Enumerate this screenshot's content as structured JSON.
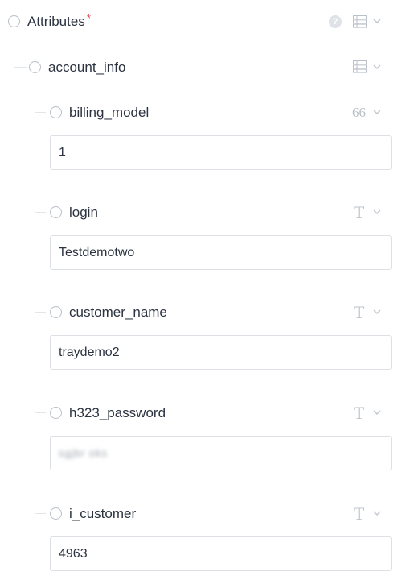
{
  "root": {
    "label": "Attributes",
    "required_marker": "*",
    "help_icon": "?",
    "type_icon": "list-icon"
  },
  "group": {
    "label": "account_info",
    "type_icon": "list-icon"
  },
  "fields": [
    {
      "name": "billing_model",
      "type_icon": "66",
      "value": "1"
    },
    {
      "name": "login",
      "type_icon": "T",
      "value": "Testdemotwo"
    },
    {
      "name": "customer_name",
      "type_icon": "T",
      "value": "traydemo2"
    },
    {
      "name": "h323_password",
      "type_icon": "T",
      "value": "sgjbr oks"
    },
    {
      "name": "i_customer",
      "type_icon": "T",
      "value": "4963"
    }
  ]
}
